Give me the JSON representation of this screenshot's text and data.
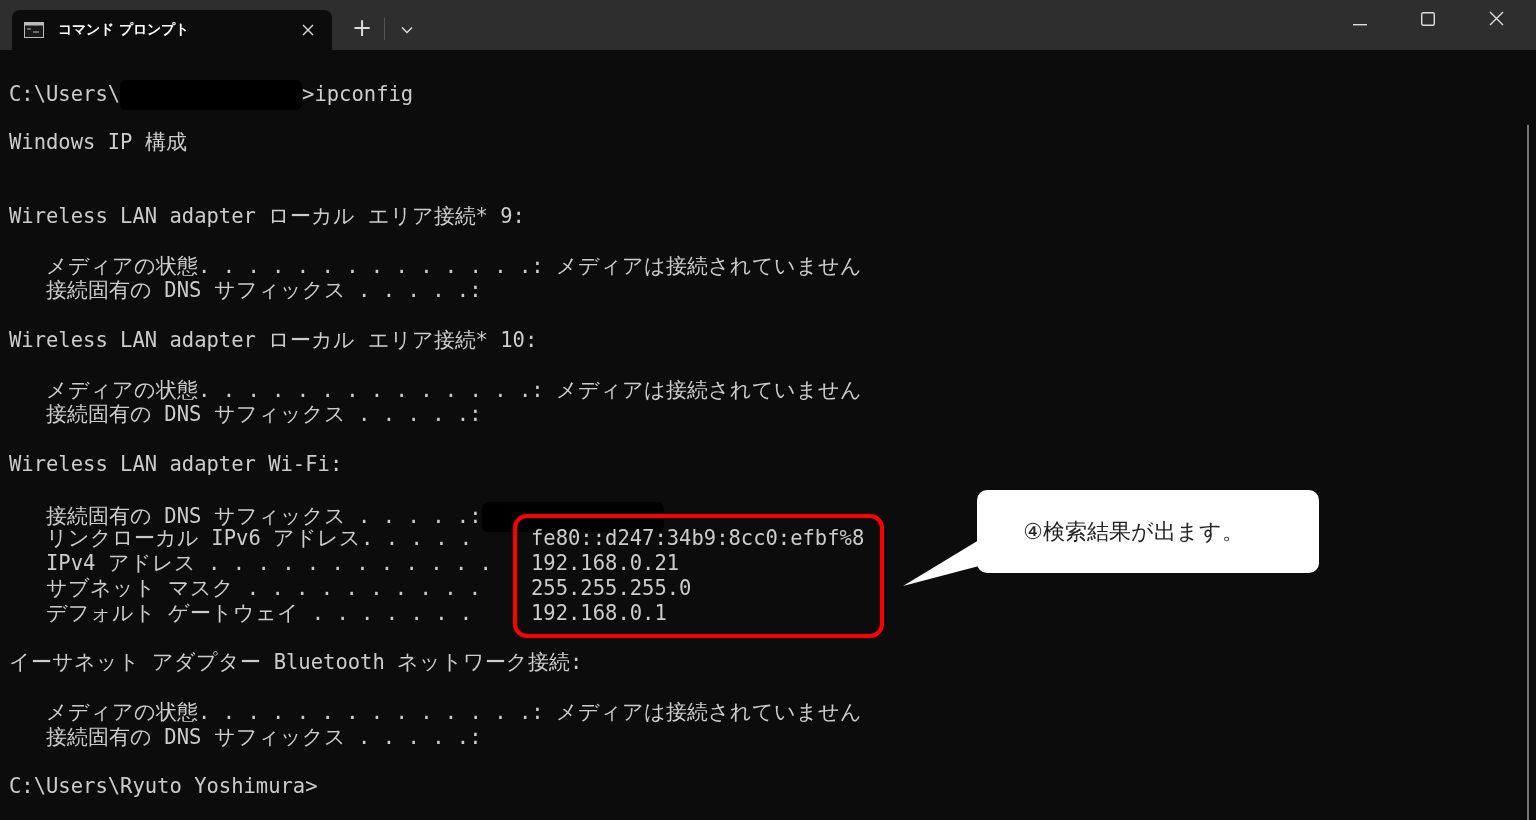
{
  "tabs": [
    {
      "title": "コマンド プロンプト",
      "selected": true
    }
  ],
  "new_tab_button": "+",
  "terminal": {
    "lines": [
      {
        "kind": "text",
        "segments": [
          {
            "kind": "text",
            "text": "C:\\Users\\"
          },
          {
            "kind": "redacted"
          },
          {
            "kind": "text",
            "text": ">ipconfig"
          }
        ]
      },
      {
        "kind": "blank"
      },
      {
        "kind": "text",
        "segments": [
          {
            "kind": "text",
            "text": "Windows IP 構成"
          }
        ]
      },
      {
        "kind": "blank"
      },
      {
        "kind": "blank"
      },
      {
        "kind": "text",
        "segments": [
          {
            "kind": "text",
            "text": "Wireless LAN adapter ローカル エリア接続* 9:"
          }
        ]
      },
      {
        "kind": "blank"
      },
      {
        "kind": "text",
        "segments": [
          {
            "kind": "text",
            "text": "   メディアの状態. . . . . . . . . . . . . .: メディアは接続されていません"
          }
        ]
      },
      {
        "kind": "text",
        "segments": [
          {
            "kind": "text",
            "text": "   接続固有の DNS サフィックス . . . . .:"
          }
        ]
      },
      {
        "kind": "blank"
      },
      {
        "kind": "text",
        "segments": [
          {
            "kind": "text",
            "text": "Wireless LAN adapter ローカル エリア接続* 10:"
          }
        ]
      },
      {
        "kind": "blank"
      },
      {
        "kind": "text",
        "segments": [
          {
            "kind": "text",
            "text": "   メディアの状態. . . . . . . . . . . . . .: メディアは接続されていません"
          }
        ]
      },
      {
        "kind": "text",
        "segments": [
          {
            "kind": "text",
            "text": "   接続固有の DNS サフィックス . . . . .:"
          }
        ]
      },
      {
        "kind": "blank"
      },
      {
        "kind": "text",
        "segments": [
          {
            "kind": "text",
            "text": "Wireless LAN adapter Wi-Fi:"
          }
        ]
      },
      {
        "kind": "blank"
      },
      {
        "kind": "text",
        "segments": [
          {
            "kind": "text",
            "text": "   接続固有の DNS サフィックス . . . . .:"
          },
          {
            "kind": "redacted"
          }
        ]
      },
      {
        "kind": "highlight",
        "rows": [
          {
            "label": "   リンクローカル IPv6 アドレス. . . . .",
            "value": "fe80::d247:34b9:8cc0:efbf%8"
          },
          {
            "label": "   IPv4 アドレス . . . . . . . . . . . .",
            "value": "192.168.0.21"
          },
          {
            "label": "   サブネット マスク . . . . . . . . . .",
            "value": "255.255.255.0"
          },
          {
            "label": "   デフォルト ゲートウェイ . . . . . . .",
            "value": "192.168.0.1"
          }
        ]
      },
      {
        "kind": "blank"
      },
      {
        "kind": "text",
        "segments": [
          {
            "kind": "text",
            "text": "イーサネット アダプター Bluetooth ネットワーク接続:"
          }
        ]
      },
      {
        "kind": "blank"
      },
      {
        "kind": "text",
        "segments": [
          {
            "kind": "text",
            "text": "   メディアの状態. . . . . . . . . . . . . .: メディアは接続されていません"
          }
        ]
      },
      {
        "kind": "text",
        "segments": [
          {
            "kind": "text",
            "text": "   接続固有の DNS サフィックス . . . . .:"
          }
        ]
      },
      {
        "kind": "blank"
      },
      {
        "kind": "text",
        "segments": [
          {
            "kind": "text",
            "text": "C:\\Users\\Ryuto Yoshimura>"
          }
        ]
      }
    ]
  },
  "callout": {
    "text": "④検索結果が出ます。"
  }
}
